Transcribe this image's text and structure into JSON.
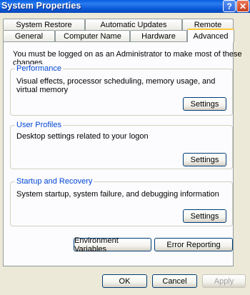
{
  "window": {
    "title": "System Properties",
    "help_label": "?",
    "close_label": "✕"
  },
  "tabs_row_back": [
    "System Restore",
    "Automatic Updates",
    "Remote"
  ],
  "tabs_row_front": [
    "General",
    "Computer Name",
    "Hardware",
    "Advanced"
  ],
  "active_tab": "Advanced",
  "admin_notice": "You must be logged on as an Administrator to make most of these changes.",
  "groups": {
    "performance": {
      "label": "Performance",
      "desc": "Visual effects, processor scheduling, memory usage, and virtual memory",
      "button": "Settings"
    },
    "user_profiles": {
      "label": "User Profiles",
      "desc": "Desktop settings related to your logon",
      "button": "Settings"
    },
    "startup": {
      "label": "Startup and Recovery",
      "desc": "System startup, system failure, and debugging information",
      "button": "Settings"
    }
  },
  "bottom_buttons": {
    "env_vars": "Environment Variables",
    "error_reporting": "Error Reporting"
  },
  "dialog_buttons": {
    "ok": "OK",
    "cancel": "Cancel",
    "apply": "Apply"
  },
  "colors": {
    "title_bar": "#0A5FE0",
    "tab_highlight": "#FFC83C",
    "group_label": "#0046D5"
  }
}
